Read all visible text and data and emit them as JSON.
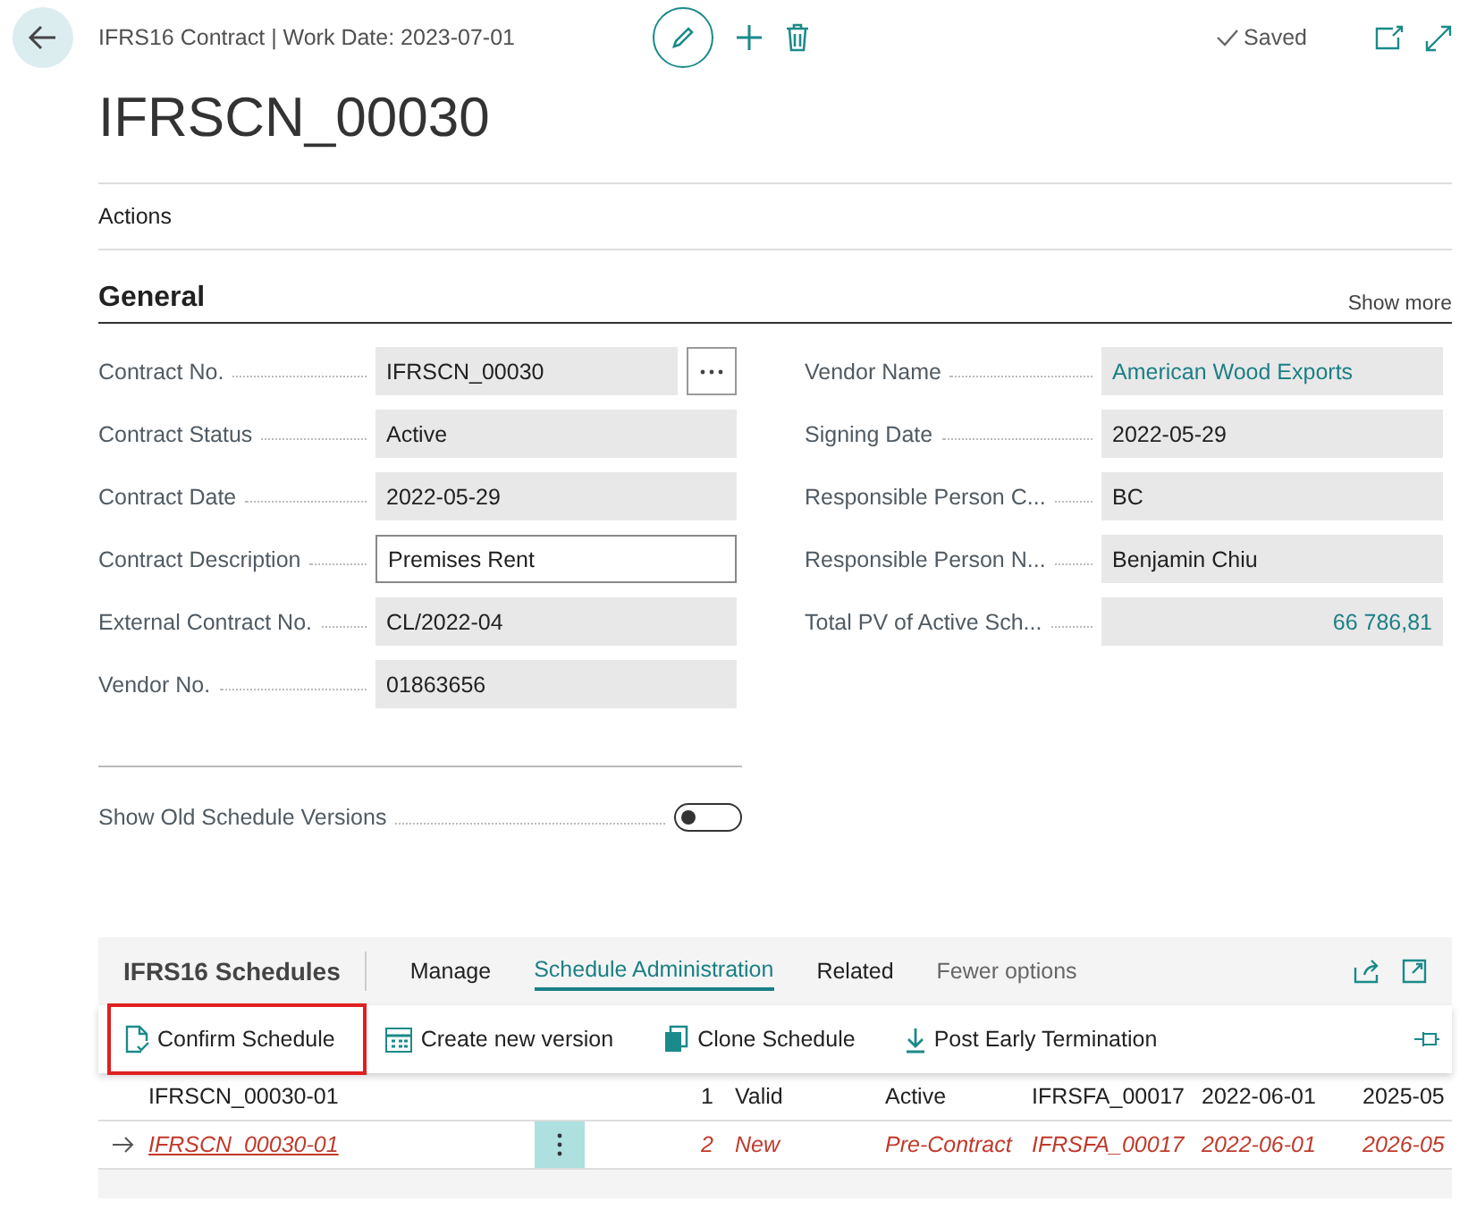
{
  "header": {
    "breadcrumb": "IFRS16 Contract | Work Date: 2023-07-01",
    "status": "Saved",
    "title": "IFRSCN_00030"
  },
  "actions_label": "Actions",
  "general": {
    "title": "General",
    "show_more": "Show more",
    "left": [
      {
        "label": "Contract No.",
        "value": "IFRSCN_00030",
        "kind": "lookup"
      },
      {
        "label": "Contract Status",
        "value": "Active",
        "kind": "readonly"
      },
      {
        "label": "Contract Date",
        "value": "2022-05-29",
        "kind": "readonly"
      },
      {
        "label": "Contract Description",
        "value": "Premises Rent",
        "kind": "editable"
      },
      {
        "label": "External Contract No.",
        "value": "CL/2022-04",
        "kind": "readonly"
      },
      {
        "label": "Vendor No.",
        "value": "01863656",
        "kind": "readonly"
      }
    ],
    "right": [
      {
        "label": "Vendor Name",
        "value": "American Wood Exports",
        "kind": "link"
      },
      {
        "label": "Signing Date",
        "value": "2022-05-29",
        "kind": "readonly"
      },
      {
        "label": "Responsible Person C...",
        "value": "BC",
        "kind": "readonly"
      },
      {
        "label": "Responsible Person N...",
        "value": "Benjamin Chiu",
        "kind": "readonly"
      },
      {
        "label": "Total PV of Active Sch...",
        "value": "66 786,81",
        "kind": "amount"
      }
    ]
  },
  "show_old_versions": {
    "label": "Show Old Schedule Versions",
    "on": false
  },
  "schedules": {
    "title": "IFRS16 Schedules",
    "tabs": [
      {
        "label": "Manage",
        "selected": false
      },
      {
        "label": "Schedule Administration",
        "selected": true
      },
      {
        "label": "Related",
        "selected": false
      },
      {
        "label": "Fewer options",
        "selected": false
      }
    ],
    "actions": [
      {
        "label": "Confirm Schedule",
        "kind": "confirm",
        "highlighted": true
      },
      {
        "label": "Create new version",
        "kind": "calendar",
        "highlighted": false
      },
      {
        "label": "Clone Schedule",
        "kind": "copy",
        "highlighted": false
      },
      {
        "label": "Post Early Termination",
        "kind": "download",
        "highlighted": false
      }
    ],
    "rows": [
      {
        "selected": false,
        "attention": false,
        "cells": [
          "IFRSCN_00030-01",
          "1",
          "Valid",
          "Active",
          "IFRSFA_00017",
          "2022-06-01",
          "2025-05"
        ]
      },
      {
        "selected": true,
        "attention": true,
        "cells": [
          "IFRSCN_00030-01",
          "2",
          "New",
          "Pre-Contract",
          "IFRSFA_00017",
          "2022-06-01",
          "2026-05"
        ]
      }
    ]
  }
}
